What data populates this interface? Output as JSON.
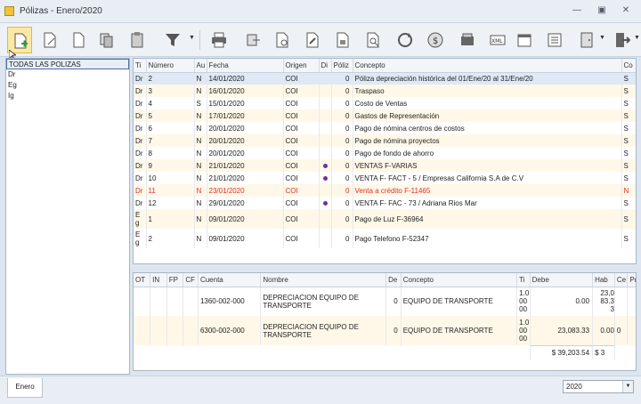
{
  "window": {
    "title": "Pólizas - Enero/2020"
  },
  "toolbar": {
    "icons": [
      "new-document",
      "edit-document",
      "blank-document",
      "copy",
      "paste",
      "filter",
      "print",
      "export",
      "report",
      "report2",
      "report3",
      "search-report",
      "refresh",
      "currency",
      "scan",
      "xml",
      "calendar",
      "list",
      "door-exit",
      "exit"
    ]
  },
  "sidebar": {
    "items": [
      {
        "label": "TODAS LAS POLIZAS"
      },
      {
        "label": "Dr"
      },
      {
        "label": "Eg"
      },
      {
        "label": "Ig"
      }
    ]
  },
  "polizas": {
    "headers": [
      "Ti",
      "Número",
      "Au",
      "Fecha",
      "Origen",
      "Di",
      "Póliz",
      "Concepto",
      "Co"
    ],
    "rows": [
      {
        "ti": "Dr",
        "num": "2",
        "au": "N",
        "fecha": "14/01/2020",
        "origen": "COI",
        "di": "",
        "pol": "0",
        "concepto": "Póliza depreciación histórica del 01/Ene/20 al 31/Ene/20",
        "co": "S"
      },
      {
        "ti": "Dr",
        "num": "3",
        "au": "N",
        "fecha": "16/01/2020",
        "origen": "COI",
        "di": "",
        "pol": "0",
        "concepto": "Traspaso",
        "co": "S"
      },
      {
        "ti": "Dr",
        "num": "4",
        "au": "S",
        "fecha": "15/01/2020",
        "origen": "COI",
        "di": "",
        "pol": "0",
        "concepto": "Costo de Ventas",
        "co": "S"
      },
      {
        "ti": "Dr",
        "num": "5",
        "au": "N",
        "fecha": "17/01/2020",
        "origen": "COI",
        "di": "",
        "pol": "0",
        "concepto": "Gastos de Representación",
        "co": "S"
      },
      {
        "ti": "Dr",
        "num": "6",
        "au": "N",
        "fecha": "20/01/2020",
        "origen": "COI",
        "di": "",
        "pol": "0",
        "concepto": "Pago de nómina centros de costos",
        "co": "S"
      },
      {
        "ti": "Dr",
        "num": "7",
        "au": "N",
        "fecha": "20/01/2020",
        "origen": "COI",
        "di": "",
        "pol": "0",
        "concepto": "Pago de nómina proyectos",
        "co": "S"
      },
      {
        "ti": "Dr",
        "num": "8",
        "au": "N",
        "fecha": "20/01/2020",
        "origen": "COI",
        "di": "",
        "pol": "0",
        "concepto": "Pago de fondo de ahorro",
        "co": "S"
      },
      {
        "ti": "Dr",
        "num": "9",
        "au": "N",
        "fecha": "21/01/2020",
        "origen": "COI",
        "di": "dot",
        "pol": "0",
        "concepto": "VENTAS F-VARIAS",
        "co": "S"
      },
      {
        "ti": "Dr",
        "num": "10",
        "au": "N",
        "fecha": "21/01/2020",
        "origen": "COI",
        "di": "dot",
        "pol": "0",
        "concepto": "VENTA F-  FACT - 5  / Empresas California S.A de C.V",
        "co": "S"
      },
      {
        "ti": "Dr",
        "num": "11",
        "au": "N",
        "fecha": "23/01/2020",
        "origen": "COI",
        "di": "",
        "pol": "0",
        "concepto": "Venta a crédito F-11465",
        "co": "N"
      },
      {
        "ti": "Dr",
        "num": "12",
        "au": "N",
        "fecha": "29/01/2020",
        "origen": "COI",
        "di": "dot",
        "pol": "0",
        "concepto": "VENTA F-  FAC - 73  / Adriana Rios Mar",
        "co": "S"
      },
      {
        "ti": "E\ng",
        "num": "1",
        "au": "N",
        "fecha": "09/01/2020",
        "origen": "COI",
        "di": "",
        "pol": "0",
        "concepto": "Pago de Luz F-36964",
        "co": "S"
      },
      {
        "ti": "E\ng",
        "num": "2",
        "au": "N",
        "fecha": "09/01/2020",
        "origen": "COI",
        "di": "",
        "pol": "0",
        "concepto": "Pago Telefono F-52347",
        "co": "S"
      }
    ]
  },
  "movimientos": {
    "headers": [
      "OT",
      "IN",
      "FP",
      "CF",
      "Cuenta",
      "Nombre",
      "De",
      "Concepto",
      "Ti",
      "Debe",
      "Hab",
      "Ce",
      "Pr"
    ],
    "rows": [
      {
        "cuenta": "1360-002-000",
        "nombre": "DEPRECIACION EQUIPO DE TRANSPORTE",
        "de": "0",
        "concepto": "EQUIPO DE TRANSPORTE",
        "ti": "1.0\n00\n00",
        "debe": "0.00",
        "hab": "23,0\n83.3\n3",
        "ce": "",
        "pr": ""
      },
      {
        "cuenta": "6300-002-000",
        "nombre": "DEPRECIACION EQUIPO DE TRANSPORTE",
        "de": "0",
        "concepto": "EQUIPO DE TRANSPORTE",
        "ti": "1.0\n00\n00",
        "debe": "23,083.33",
        "hab": "0.00",
        "ce": "0",
        "pr": ""
      }
    ],
    "total_debe": "$ 39,203.54",
    "total_hab": "$ 3"
  },
  "status": {
    "tab": "Enero",
    "year": "2020"
  }
}
